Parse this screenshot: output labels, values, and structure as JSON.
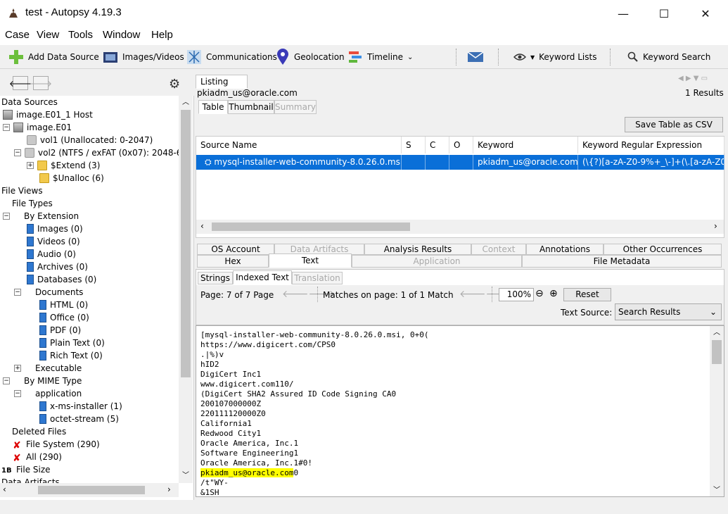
{
  "window": {
    "title": "test - Autopsy 4.19.3",
    "minimize": "—",
    "maximize": "☐",
    "close": "✕"
  },
  "menu": [
    "Case",
    "View",
    "Tools",
    "Window",
    "Help"
  ],
  "toolbar": {
    "add_data_source": "Add Data Source",
    "images_videos": "Images/Videos",
    "communications": "Communications",
    "geolocation": "Geolocation",
    "timeline": "Timeline",
    "keyword_lists": "Keyword Lists",
    "keyword_search": "Keyword Search"
  },
  "tree": [
    "Data Sources",
    "image.E01_1 Host",
    "image.E01",
    "vol1 (Unallocated: 0-2047)",
    "vol2 (NTFS / exFAT (0x07): 2048-61",
    "$Extend (3)",
    "$Unalloc (6)",
    "File Views",
    "File Types",
    "By Extension",
    "Images (0)",
    "Videos (0)",
    "Audio (0)",
    "Archives (0)",
    "Databases (0)",
    "Documents",
    "HTML (0)",
    "Office (0)",
    "PDF (0)",
    "Plain Text (0)",
    "Rich Text (0)",
    "Executable",
    "By MIME Type",
    "application",
    "x-ms-installer (1)",
    "octet-stream (5)",
    "Deleted Files",
    "File System (290)",
    "All (290)",
    "File Size",
    "Data Artifacts"
  ],
  "listing": {
    "tab": "Listing",
    "query": "pkiadm_us@oracle.com",
    "results": "1  Results",
    "view_tabs": [
      "Table",
      "Thumbnail",
      "Summary"
    ],
    "save_csv": "Save Table as CSV",
    "columns": [
      "Source Name",
      "S",
      "C",
      "O",
      "Keyword",
      "Keyword Regular Expression"
    ],
    "row": {
      "source": "mysql-installer-web-community-8.0.26.0.msi",
      "s": "",
      "c": "",
      "o": "",
      "keyword": "pkiadm_us@oracle.com",
      "regex": "(\\{?)[a-zA-Z0-9%+_\\-]+(\\.[a-zA-Z0-"
    }
  },
  "content_tabs_row1": [
    "OS Account",
    "Data Artifacts",
    "Analysis Results",
    "Context",
    "Annotations",
    "Other Occurrences"
  ],
  "content_tabs_row2": [
    "Hex",
    "Text",
    "Application",
    "File Metadata"
  ],
  "text_tabs": [
    "Strings",
    "Indexed Text",
    "Translation"
  ],
  "pager": {
    "page": "Page: 7 of 7 Page",
    "matches": "Matches on page: 1 of 1 Match",
    "zoom": "100%",
    "reset": "Reset",
    "text_source_label": "Text Source:",
    "text_source_value": "Search Results"
  },
  "text_lines": [
    "[mysql-installer-web-community-8.0.26.0.msi, 0+0(",
    "https://www.digicert.com/CPS0",
    ".|%)v",
    "hID2",
    "DigiCert Inc1",
    "www.digicert.com110/",
    "(DigiCert SHA2 Assured ID Code Signing CA0",
    "200107000000Z",
    "220111120000Z0",
    "California1",
    "Redwood City1",
    "Oracle America, Inc.1",
    "Software Engineering1",
    "Oracle America, Inc.1#0!",
    "",
    "/t\"WY-",
    "&1SH"
  ],
  "highlight_line": {
    "match": "pkiadm_us@oracle.com",
    "rest": "0"
  }
}
